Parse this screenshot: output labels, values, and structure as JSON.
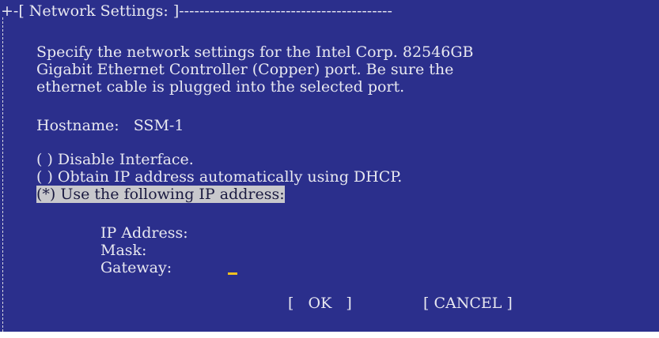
{
  "dialog": {
    "frame_prefix": "+-[ ",
    "title": "Network Settings:",
    "frame_suffix": " ]------------------------------------------",
    "description_lines": [
      "Specify the network settings for the Intel Corp. 82546GB",
      "Gigabit Ethernet Controller (Copper) port. Be sure the",
      "ethernet cable is plugged into the selected port."
    ]
  },
  "hostname": {
    "label": "Hostname:",
    "value": "SSM-1"
  },
  "options": [
    {
      "marker": "( )",
      "label": "Disable Interface.",
      "selected": false
    },
    {
      "marker": "( )",
      "label": "Obtain IP address automatically using DHCP.",
      "selected": false
    },
    {
      "marker": "(*)",
      "label": "Use the following IP address:",
      "selected": true
    }
  ],
  "fields": {
    "ip_label": "IP Address:",
    "mask_label": "Mask:",
    "gateway_label": "Gateway:",
    "ip_value": "",
    "mask_value": "",
    "gateway_value": ""
  },
  "buttons": {
    "ok": "[   OK   ]",
    "cancel": "[ CANCEL ]"
  },
  "colors": {
    "background": "#2b2f8c",
    "text": "#e8e8f0",
    "highlight": "#c8c8cc",
    "cursor": "#f0c020"
  }
}
